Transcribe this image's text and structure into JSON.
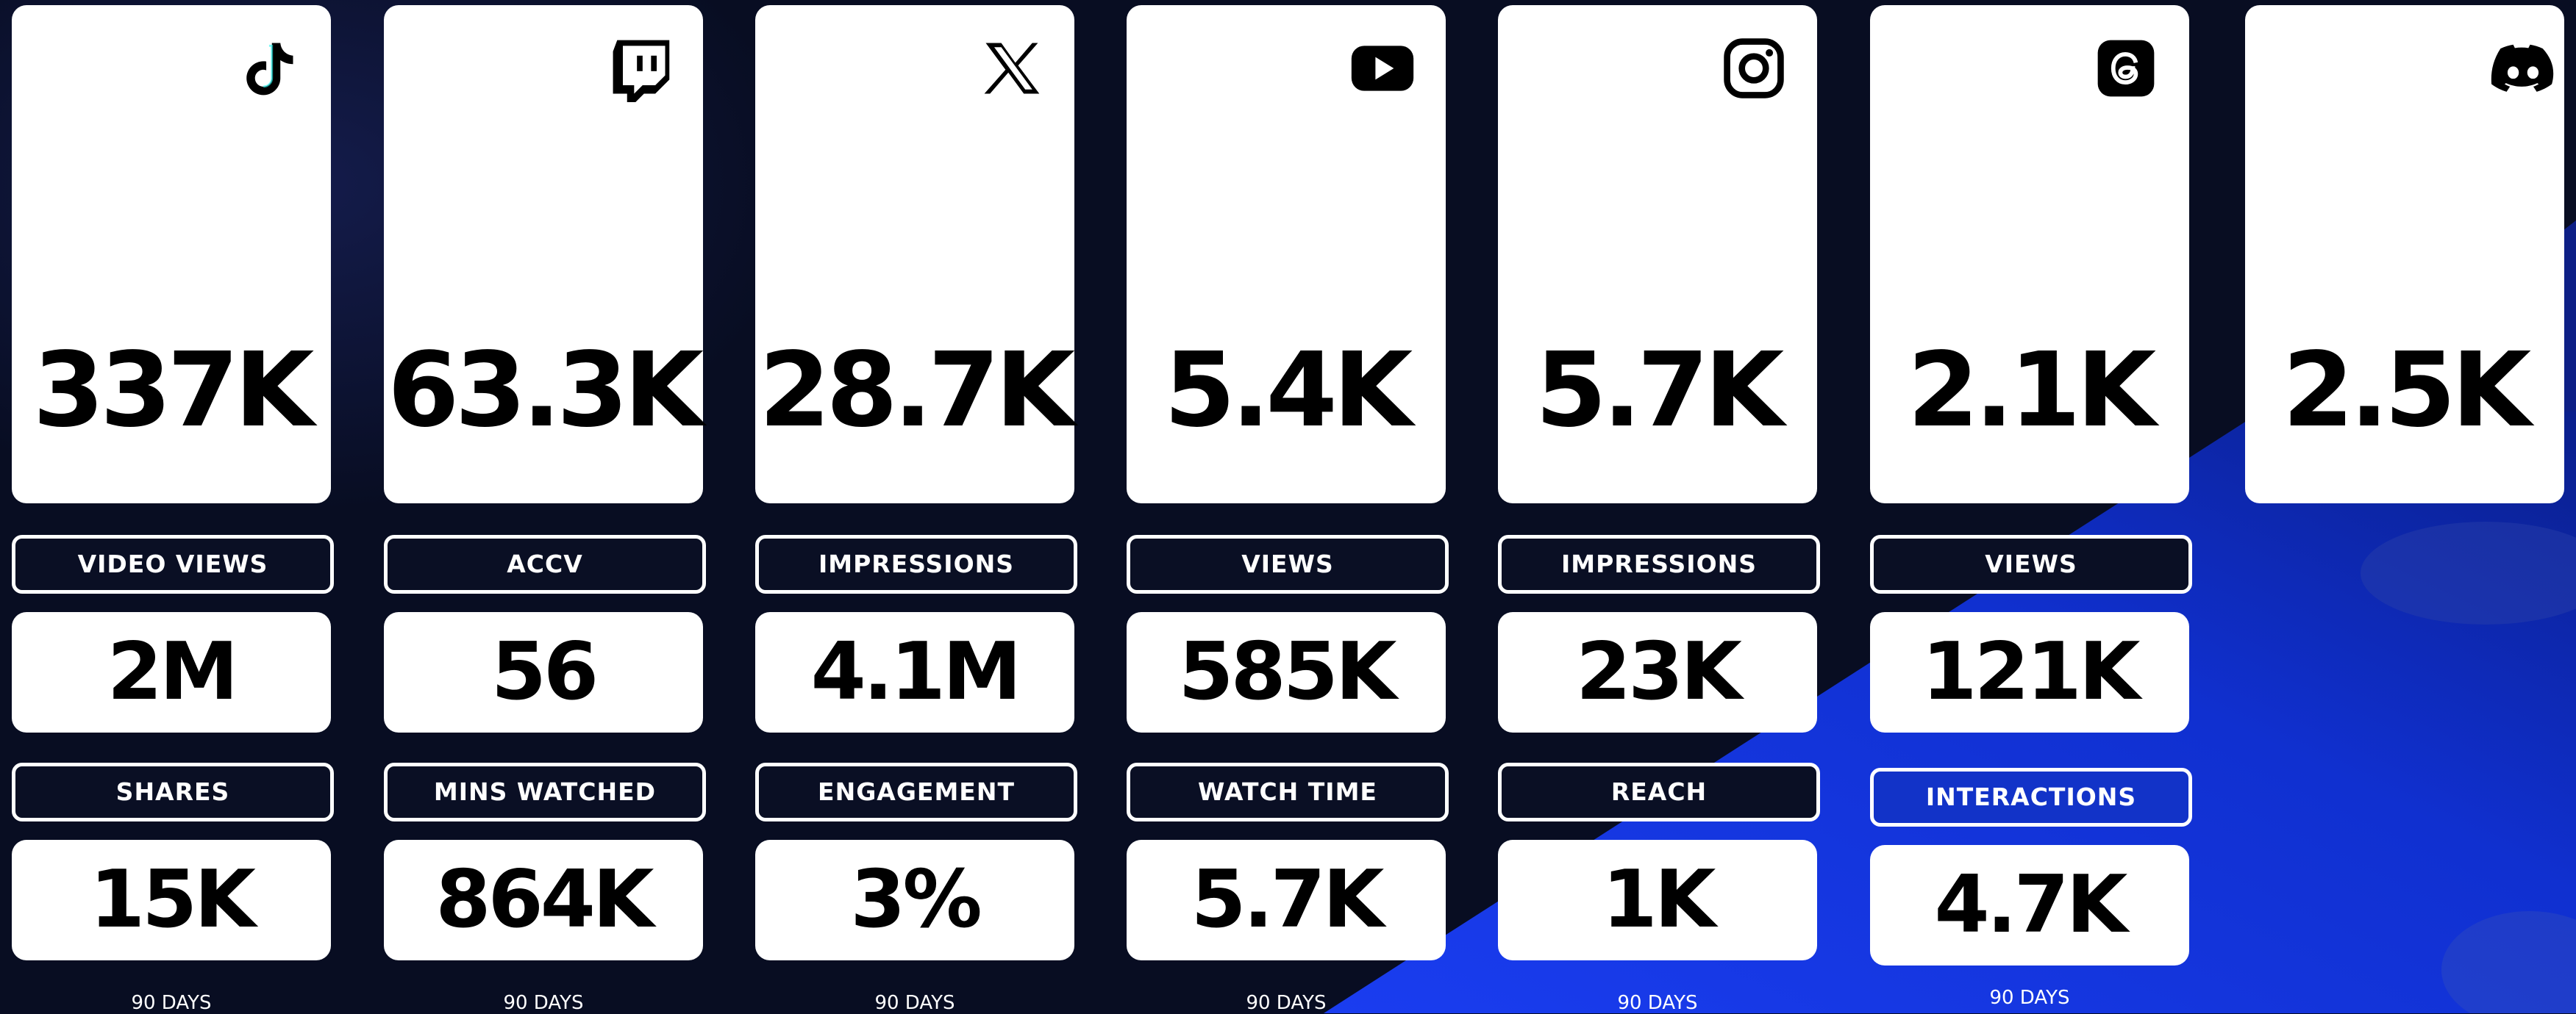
{
  "columns": [
    {
      "platform": "tiktok",
      "icon": "tiktok-icon",
      "big": "337K",
      "m1_label": "VIDEO VIEWS",
      "m1_value": "2M",
      "m2_label": "SHARES",
      "m2_value": "15K",
      "period": "90 DAYS"
    },
    {
      "platform": "twitch",
      "icon": "twitch-icon",
      "big": "63.3K",
      "m1_label": "ACCV",
      "m1_value": "56",
      "m2_label": "MINS WATCHED",
      "m2_value": "864K",
      "period": "90 DAYS"
    },
    {
      "platform": "x",
      "icon": "x-icon",
      "big": "28.7K",
      "m1_label": "IMPRESSIONS",
      "m1_value": "4.1M",
      "m2_label": "ENGAGEMENT",
      "m2_value": "3%",
      "period": "90 DAYS"
    },
    {
      "platform": "youtube",
      "icon": "youtube-icon",
      "big": "5.4K",
      "m1_label": "VIEWS",
      "m1_value": "585K",
      "m2_label": "WATCH TIME",
      "m2_value": "5.7K",
      "period": "90 DAYS"
    },
    {
      "platform": "instagram",
      "icon": "instagram-icon",
      "big": "5.7K",
      "m1_label": "IMPRESSIONS",
      "m1_value": "23K",
      "m2_label": "REACH",
      "m2_value": "1K",
      "period": "90 DAYS"
    },
    {
      "platform": "threads",
      "icon": "threads-icon",
      "big": "2.1K",
      "m1_label": "VIEWS",
      "m1_value": "121K",
      "m2_label": "INTERACTIONS",
      "m2_value": "4.7K",
      "period": "90 DAYS"
    },
    {
      "platform": "discord",
      "icon": "discord-icon",
      "big": "2.5K"
    }
  ],
  "colors": {
    "background": "#080d22",
    "accent_blue": "#1233c8",
    "card": "#ffffff",
    "text": "#000000"
  }
}
